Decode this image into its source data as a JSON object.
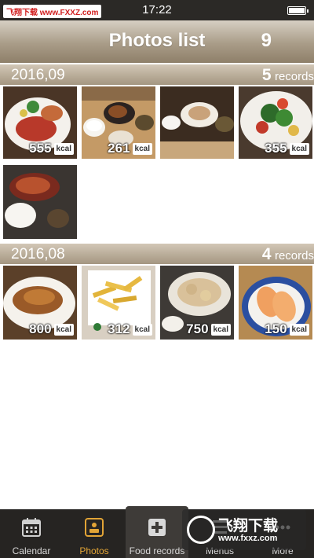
{
  "status_bar": {
    "time": "17:22",
    "watermark": "飞翔下载 www.FXXZ.com"
  },
  "header": {
    "title": "Photos list",
    "count": "9"
  },
  "sections": [
    {
      "label": "2016,09",
      "count": "5",
      "records_word": "records",
      "items": [
        {
          "kcal": "555"
        },
        {
          "kcal": "261"
        },
        {
          "kcal": ""
        },
        {
          "kcal": "355"
        },
        {
          "kcal": ""
        }
      ]
    },
    {
      "label": "2016,08",
      "count": "4",
      "records_word": "records",
      "items": [
        {
          "kcal": "800"
        },
        {
          "kcal": "312"
        },
        {
          "kcal": "750"
        },
        {
          "kcal": "150"
        }
      ]
    }
  ],
  "kcal_unit": "kcal",
  "tabs": [
    {
      "label": "Calendar",
      "icon": "calendar-icon"
    },
    {
      "label": "Photos",
      "icon": "photos-icon",
      "active": true
    },
    {
      "label": "Food records",
      "icon": "plus-icon"
    },
    {
      "label": "Menus",
      "icon": "menu-icon"
    },
    {
      "label": "More",
      "icon": "more-icon"
    }
  ],
  "watermark_bottom": {
    "line1": "飞翔下载",
    "line2": "www.fxxz.com"
  },
  "colors": {
    "accent": "#e2a436",
    "header_brown": "#a99c88",
    "tabbar": "#262422"
  }
}
